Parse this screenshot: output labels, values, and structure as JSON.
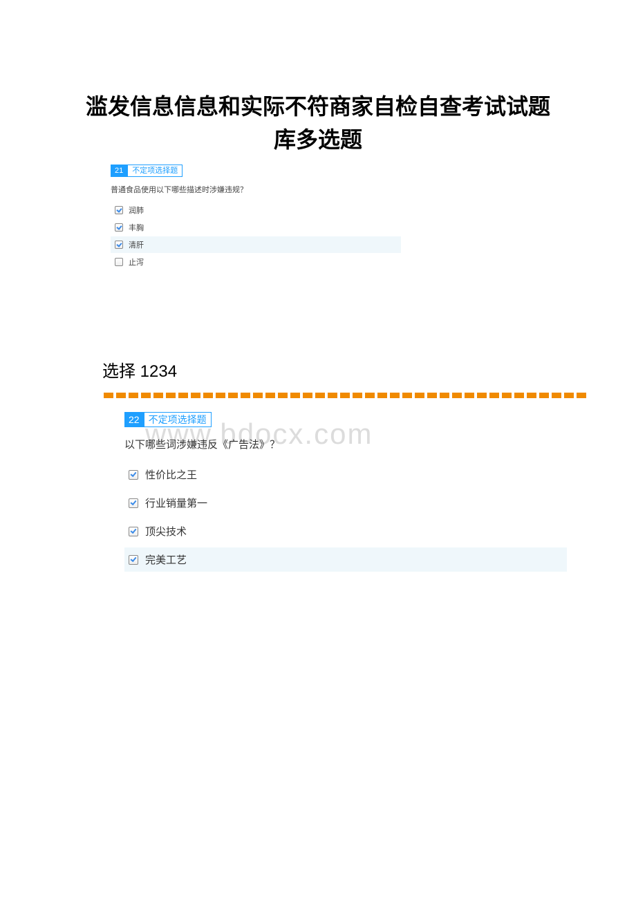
{
  "title": "滥发信息信息和实际不符商家自检自查考试试题库多选题",
  "watermark": "www.bdocx.com",
  "answer_tag": "选择 1234",
  "question1": {
    "number": "21",
    "type_label": "不定项选择题",
    "text": "普通食品使用以下哪些描述时涉嫌违规？",
    "options": {
      "o1": {
        "label": "润肺",
        "checked": true,
        "highlight": false
      },
      "o2": {
        "label": "丰胸",
        "checked": true,
        "highlight": false
      },
      "o3": {
        "label": "清肝",
        "checked": true,
        "highlight": true
      },
      "o4": {
        "label": "止泻",
        "checked": false,
        "highlight": false
      }
    }
  },
  "question2": {
    "number": "22",
    "type_label": "不定项选择题",
    "text": "以下哪些词涉嫌违反《广告法》？",
    "options": {
      "o1": {
        "label": "性价比之王",
        "checked": true,
        "highlight": false
      },
      "o2": {
        "label": "行业销量第一",
        "checked": true,
        "highlight": false
      },
      "o3": {
        "label": "顶尖技术",
        "checked": true,
        "highlight": false
      },
      "o4": {
        "label": "完美工艺",
        "checked": true,
        "highlight": true
      }
    }
  }
}
